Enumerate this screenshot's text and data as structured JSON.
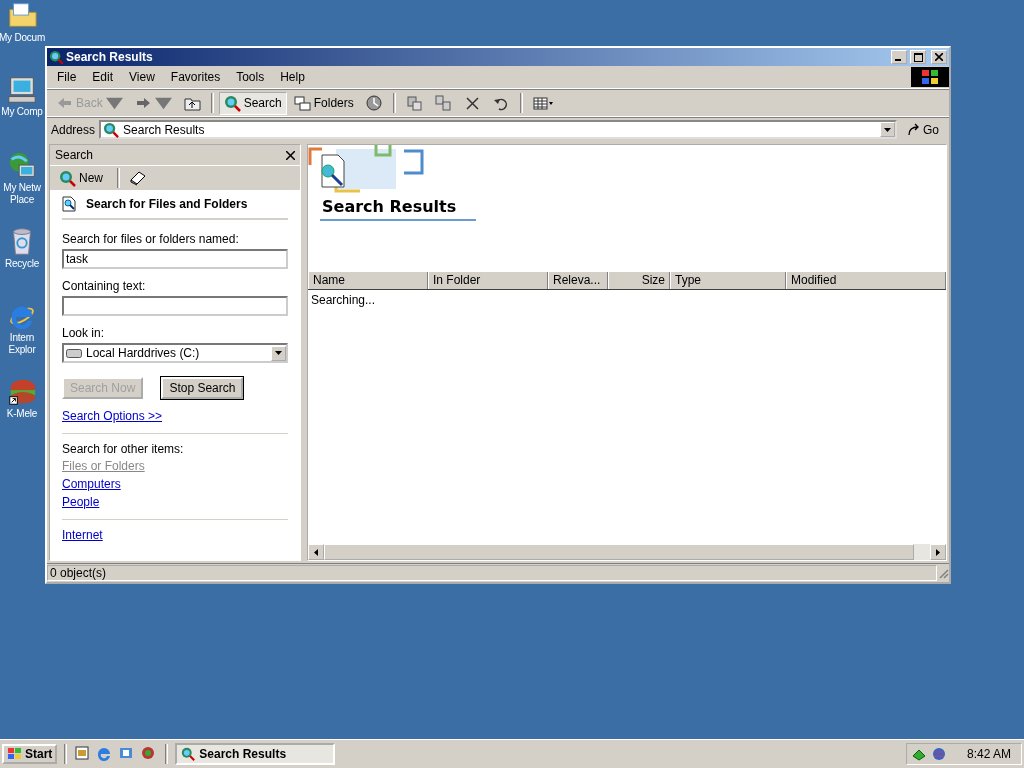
{
  "desktop_icons": [
    {
      "kind": "folder",
      "lines": [
        "My Docum"
      ]
    },
    {
      "kind": "computer",
      "lines": [
        "My Comp"
      ]
    },
    {
      "kind": "network",
      "lines": [
        "My Netw",
        "Place"
      ]
    },
    {
      "kind": "recycle",
      "lines": [
        "Recycle"
      ]
    },
    {
      "kind": "ie",
      "lines": [
        "Intern",
        "Explor"
      ]
    },
    {
      "kind": "burger",
      "lines": [
        "K-Mele"
      ]
    }
  ],
  "window": {
    "title": "Search Results",
    "menu": [
      "File",
      "Edit",
      "View",
      "Favorites",
      "Tools",
      "Help"
    ],
    "toolbar": [
      {
        "kind": "back",
        "label": "Back",
        "disabled": true
      },
      {
        "kind": "forward"
      },
      {
        "kind": "up"
      },
      {
        "kind": "search",
        "label": "Search",
        "selected": true
      },
      {
        "kind": "folders",
        "label": "Folders",
        "selected": false
      },
      {
        "kind": "history"
      },
      {
        "kind": "move"
      },
      {
        "kind": "copy"
      },
      {
        "kind": "delete"
      },
      {
        "kind": "undo"
      },
      {
        "kind": "views"
      }
    ],
    "address": {
      "label": "Address",
      "value": "Search Results",
      "go": "Go"
    },
    "search_pane": {
      "title": "Search",
      "new": "New",
      "heading": "Search for Files and Folders",
      "fields": [
        {
          "label": "Search for files or folders named:",
          "value": "task"
        },
        {
          "label": "Containing text:"
        }
      ],
      "look_in": {
        "label": "Look in:",
        "value": "Local Harddrives (C:)"
      },
      "buttons": [
        {
          "label": "Search Now",
          "disabled": true
        },
        {
          "label": "Stop Search",
          "disabled": false
        }
      ],
      "options_link": "Search Options >>",
      "other_heading": "Search for other items:",
      "other_links": [
        {
          "label": "Files or Folders",
          "disabled": true
        },
        {
          "label": "Computers",
          "disabled": false
        },
        {
          "label": "People",
          "disabled": false
        }
      ],
      "internet_link": "Internet"
    },
    "results": {
      "title": "Search Results",
      "columns": [
        {
          "label": "Name"
        },
        {
          "label": "In Folder"
        },
        {
          "label": "Releva..."
        },
        {
          "label": "Size"
        },
        {
          "label": "Type"
        },
        {
          "label": "Modified"
        }
      ],
      "status": "Searching..."
    },
    "status_bar": "0 object(s)"
  },
  "taskbar": {
    "start": "Start",
    "tasks": [
      {
        "label": "Search Results",
        "selected": true
      }
    ],
    "clock": "8:42 AM"
  }
}
